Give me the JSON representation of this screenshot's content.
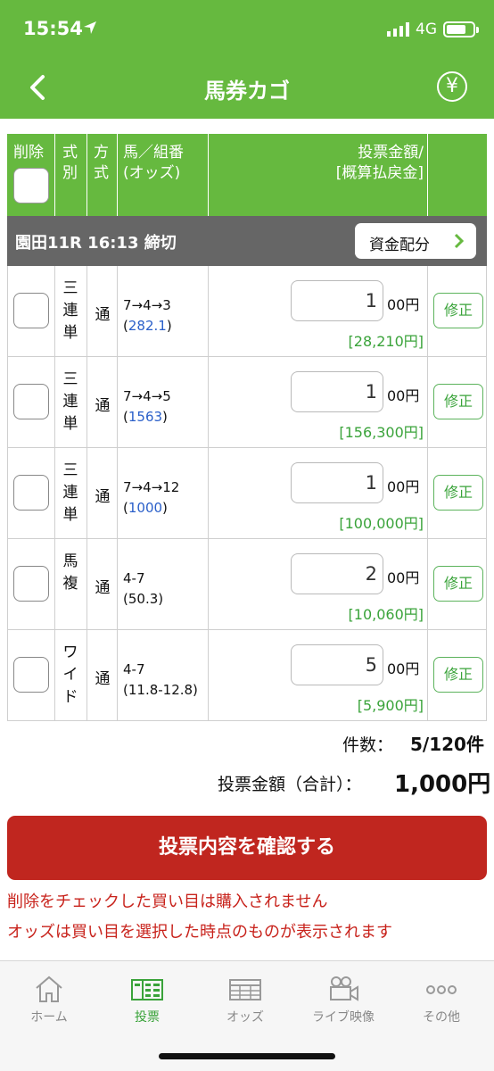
{
  "status_bar": {
    "time": "15:54",
    "network": "4G"
  },
  "nav": {
    "title": "馬券カゴ",
    "back_icon": "chevron-left-icon",
    "yen_symbol": "¥"
  },
  "table_header": {
    "delete": "削除",
    "type_l1": "式",
    "type_l2": "別",
    "method_l1": "方",
    "method_l2": "式",
    "combo_l1": "馬／組番",
    "combo_l2": "(オッズ)",
    "amount_l1": "投票金額/",
    "amount_l2": "[概算払戻金]"
  },
  "race": {
    "label": "園田11R 16:13 締切",
    "allocate_button": "資金配分"
  },
  "bets": [
    {
      "type_chars": [
        "三",
        "連",
        "単"
      ],
      "method": "通",
      "combo": "7→4→3",
      "odds_open": "(",
      "odds": "282.1",
      "odds_close": ")",
      "amount": "1",
      "unit": "00円",
      "payout": "[28,210円]",
      "edit": "修正"
    },
    {
      "type_chars": [
        "三",
        "連",
        "単"
      ],
      "method": "通",
      "combo": "7→4→5",
      "odds_open": "(",
      "odds": "1563",
      "odds_close": ")",
      "amount": "1",
      "unit": "00円",
      "payout": "[156,300円]",
      "edit": "修正"
    },
    {
      "type_chars": [
        "三",
        "連",
        "単"
      ],
      "method": "通",
      "combo": "7→4→12",
      "odds_open": "(",
      "odds": "1000",
      "odds_close": ")",
      "amount": "1",
      "unit": "00円",
      "payout": "[100,000円]",
      "edit": "修正"
    },
    {
      "type_chars": [
        "馬",
        "複",
        ""
      ],
      "method": "通",
      "combo": "4-7",
      "odds_open": "",
      "odds_plain": "(50.3)",
      "odds": "",
      "odds_close": "",
      "amount": "2",
      "unit": "00円",
      "payout": "[10,060円]",
      "edit": "修正"
    },
    {
      "type_chars": [
        "ワ",
        "イ",
        "ド"
      ],
      "method": "通",
      "combo": "4-7",
      "odds_open": "",
      "odds_plain": "(11.8-12.8)",
      "odds": "",
      "odds_close": "",
      "amount": "5",
      "unit": "00円",
      "payout": "[5,900円]",
      "edit": "修正"
    }
  ],
  "summary": {
    "count_label": "件数：",
    "count_value": "5/120件",
    "total_label": "投票金額（合計）：",
    "total_value": "1,000円"
  },
  "confirm_button": "投票内容を確認する",
  "notices": [
    "削除をチェックした買い目は購入されません",
    "オッズは買い目を選択した時点のものが表示されます"
  ],
  "tabs": [
    {
      "label": "ホーム",
      "icon": "home-icon",
      "active": false
    },
    {
      "label": "投票",
      "icon": "ticket-icon",
      "active": true
    },
    {
      "label": "オッズ",
      "icon": "odds-table-icon",
      "active": false
    },
    {
      "label": "ライブ映像",
      "icon": "video-camera-icon",
      "active": false
    },
    {
      "label": "その他",
      "icon": "more-dots-icon",
      "active": false
    }
  ],
  "colors": {
    "brand_green": "#66b93f",
    "alert_red": "#c0261f",
    "odds_blue": "#2a5fc9",
    "payout_green": "#3aa33a"
  }
}
